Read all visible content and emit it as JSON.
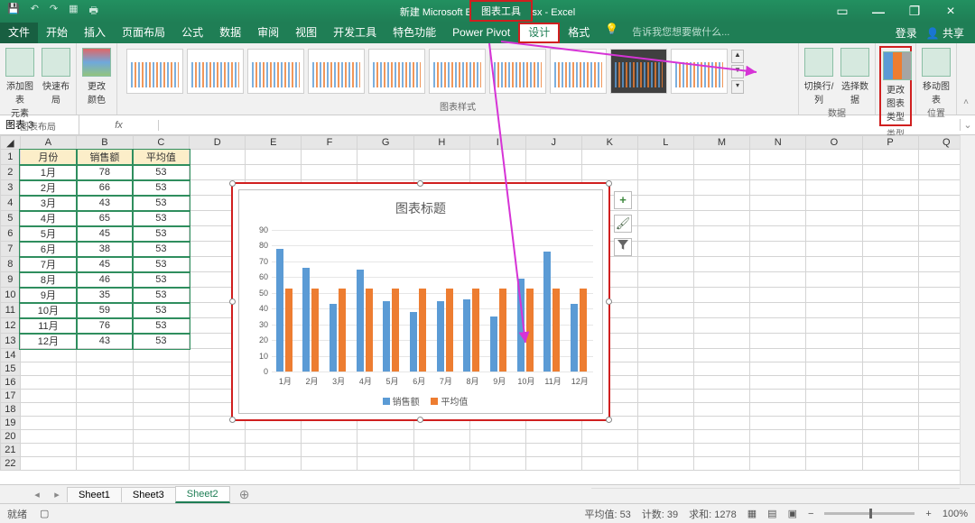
{
  "window": {
    "title": "新建 Microsoft Excel 工作表.xlsx - Excel",
    "chart_tools": "图表工具",
    "login": "登录",
    "share": "共享"
  },
  "tabs": {
    "file": "文件",
    "home": "开始",
    "insert": "插入",
    "layout": "页面布局",
    "formula": "公式",
    "data": "数据",
    "review": "审阅",
    "view": "视图",
    "dev": "开发工具",
    "special": "特色功能",
    "powerpivot": "Power Pivot",
    "design": "设计",
    "format": "格式",
    "tell_me": "告诉我您想要做什么..."
  },
  "ribbon": {
    "g1": {
      "add_element": "添加图表\n元素",
      "quick_layout": "快速布局",
      "label": "图表布局"
    },
    "g2": {
      "change_color": "更改\n颜色",
      "label": "图表样式"
    },
    "g3": {
      "swap": "切换行/列",
      "select_data": "选择数据",
      "label": "数据"
    },
    "g4": {
      "change_type": "更改\n图表类型",
      "label": "类型"
    },
    "g5": {
      "move_chart": "移动图表",
      "label": "位置"
    }
  },
  "namebox": "图表 3",
  "fx_label": "fx",
  "columns": [
    "A",
    "B",
    "C",
    "D",
    "E",
    "F",
    "G",
    "H",
    "I",
    "J",
    "K",
    "L",
    "M",
    "N",
    "O",
    "P",
    "Q"
  ],
  "headers": {
    "A": "月份",
    "B": "销售额",
    "C": "平均值"
  },
  "rows": [
    {
      "A": "1月",
      "B": 78,
      "C": 53
    },
    {
      "A": "2月",
      "B": 66,
      "C": 53
    },
    {
      "A": "3月",
      "B": 43,
      "C": 53
    },
    {
      "A": "4月",
      "B": 65,
      "C": 53
    },
    {
      "A": "5月",
      "B": 45,
      "C": 53
    },
    {
      "A": "6月",
      "B": 38,
      "C": 53
    },
    {
      "A": "7月",
      "B": 45,
      "C": 53
    },
    {
      "A": "8月",
      "B": 46,
      "C": 53
    },
    {
      "A": "9月",
      "B": 35,
      "C": 53
    },
    {
      "A": "10月",
      "B": 59,
      "C": 53
    },
    {
      "A": "11月",
      "B": 76,
      "C": 53
    },
    {
      "A": "12月",
      "B": 43,
      "C": 53
    }
  ],
  "chart": {
    "title": "图表标题",
    "legend1": "销售额",
    "legend2": "平均值"
  },
  "chart_data": {
    "type": "bar",
    "title": "图表标题",
    "categories": [
      "1月",
      "2月",
      "3月",
      "4月",
      "5月",
      "6月",
      "7月",
      "8月",
      "9月",
      "10月",
      "11月",
      "12月"
    ],
    "series": [
      {
        "name": "销售额",
        "color": "#5b9bd5",
        "values": [
          78,
          66,
          43,
          65,
          45,
          38,
          45,
          46,
          35,
          59,
          76,
          43
        ]
      },
      {
        "name": "平均值",
        "color": "#ed7d31",
        "values": [
          53,
          53,
          53,
          53,
          53,
          53,
          53,
          53,
          53,
          53,
          53,
          53
        ]
      }
    ],
    "ylim": [
      0,
      90
    ],
    "yticks": [
      0,
      10,
      20,
      30,
      40,
      50,
      60,
      70,
      80,
      90
    ],
    "xlabel": "",
    "ylabel": ""
  },
  "side_tools": {
    "plus": "+",
    "brush": "🖌",
    "filter": "▼"
  },
  "sheets": {
    "s1": "Sheet1",
    "s3": "Sheet3",
    "s2": "Sheet2",
    "add": "⊕"
  },
  "status": {
    "ready": "就绪",
    "avg": "平均值: 53",
    "count": "计数: 39",
    "sum": "求和: 1278",
    "zoom": "100%"
  }
}
